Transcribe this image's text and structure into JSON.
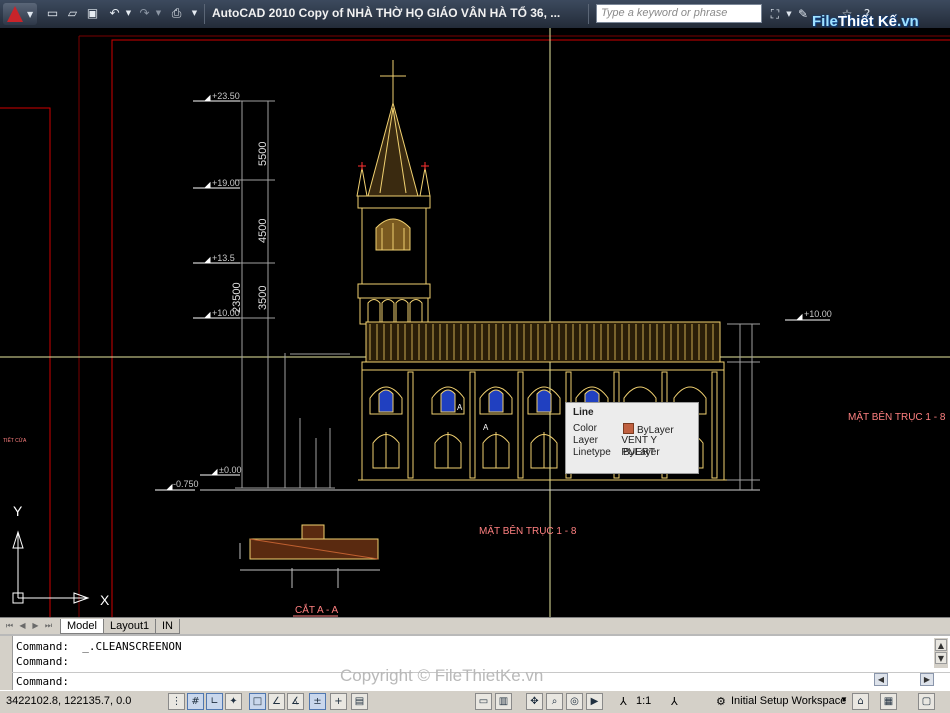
{
  "app": {
    "title": "AutoCAD 2010    Copy of NHÀ THỜ HỌ GIÁO VÂN HÀ TỔ 36, ...",
    "search_placeholder": "Type a keyword or phrase",
    "brand_part1": "File",
    "brand_part2": "Thiết Kế",
    "brand_part3": ".vn"
  },
  "drawing": {
    "elevations": {
      "e1": "+23.50",
      "e2": "+19.00",
      "e3": "+13.5",
      "e4": "+10.00",
      "e5": "+10.00",
      "e6": "±0.00",
      "e7": "-0.750"
    },
    "dims": {
      "d5500": "5500",
      "d4500": "4500",
      "d3500": "3500",
      "d23500": "23500"
    },
    "labels": {
      "title_main": "MẶT BÊN TRỤC 1 - 8",
      "title_right": "MẶT BÊN TRỤC 1 - 8",
      "section": "CẮT A - A",
      "left_fragment": "TIẾT CỬA",
      "axis_y": "Y",
      "axis_x": "X",
      "mark_a1": "A",
      "mark_a2": "A"
    }
  },
  "tooltip": {
    "title": "Line",
    "color_label": "Color",
    "color_value": "ByLayer",
    "layer_label": "Layer",
    "layer_value": "VENT Y PUERT",
    "linetype_label": "Linetype",
    "linetype_value": "ByLayer"
  },
  "tabs": [
    {
      "label": "Model",
      "active": true
    },
    {
      "label": "Layout1",
      "active": false
    },
    {
      "label": "IN",
      "active": false
    }
  ],
  "command": {
    "line1": "Command:  _.CLEANSCREENON",
    "line2": "Command:",
    "prompt": "Command:"
  },
  "watermark": "Copyright © FileThietKe.vn",
  "status": {
    "coords": "3422102.8, 122135.7, 0.0",
    "scale": "1:1",
    "workspace": "Initial Setup Workspace"
  },
  "colors": {
    "yellow_line": "#e8e8a0",
    "red_border": "#d00000",
    "structure": "#f0d070",
    "window_blue": "#2040c0"
  }
}
